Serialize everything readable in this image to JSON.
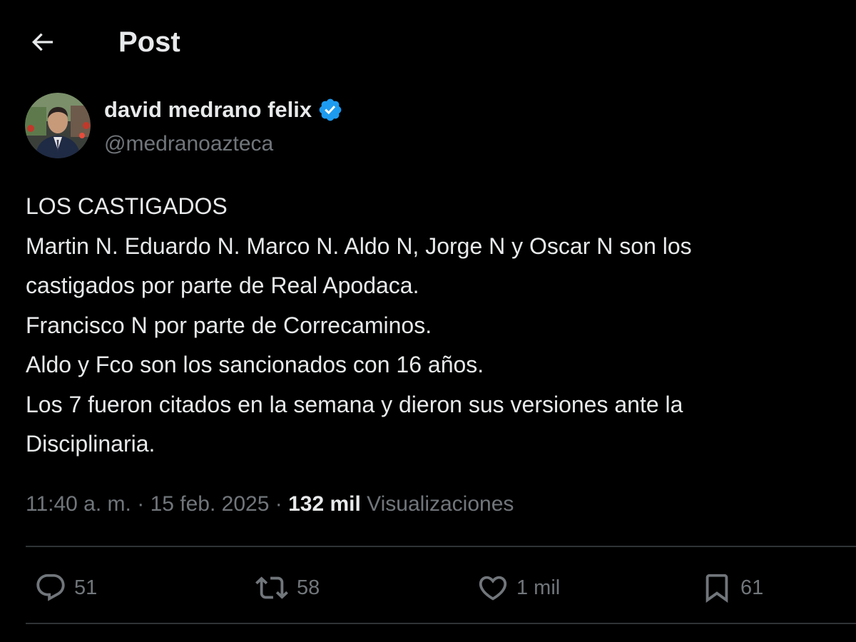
{
  "header": {
    "title": "Post",
    "back_icon": "arrow-left-icon"
  },
  "author": {
    "name": "david medrano felix",
    "handle": "@medranoazteca",
    "verified_icon": "verified-badge-icon",
    "verified_color": "#1d9bf0"
  },
  "post": {
    "lines": [
      "LOS CASTIGADOS",
      "Martin N. Eduardo N. Marco N. Aldo N, Jorge N y Oscar N son los",
      "castigados por parte de Real Apodaca.",
      "Francisco N por parte de Correcaminos.",
      "Aldo y Fco son los sancionados con 16 años.",
      "Los 7 fueron citados en la semana y dieron sus versiones ante la",
      "Disciplinaria."
    ],
    "time": "11:40 a. m.",
    "separator": "·",
    "date": "15 feb. 2025",
    "views_count": "132 mil",
    "views_label": "Visualizaciones"
  },
  "actions": {
    "replies": {
      "icon": "reply-icon",
      "count": "51"
    },
    "reposts": {
      "icon": "repost-icon",
      "count": "58"
    },
    "likes": {
      "icon": "heart-icon",
      "count": "1 mil"
    },
    "bookmarks": {
      "icon": "bookmark-icon",
      "count": "61"
    }
  },
  "colors": {
    "background": "#000000",
    "text": "#e7e9ea",
    "muted": "#71767b",
    "divider": "#2f3336",
    "accent": "#1d9bf0"
  }
}
